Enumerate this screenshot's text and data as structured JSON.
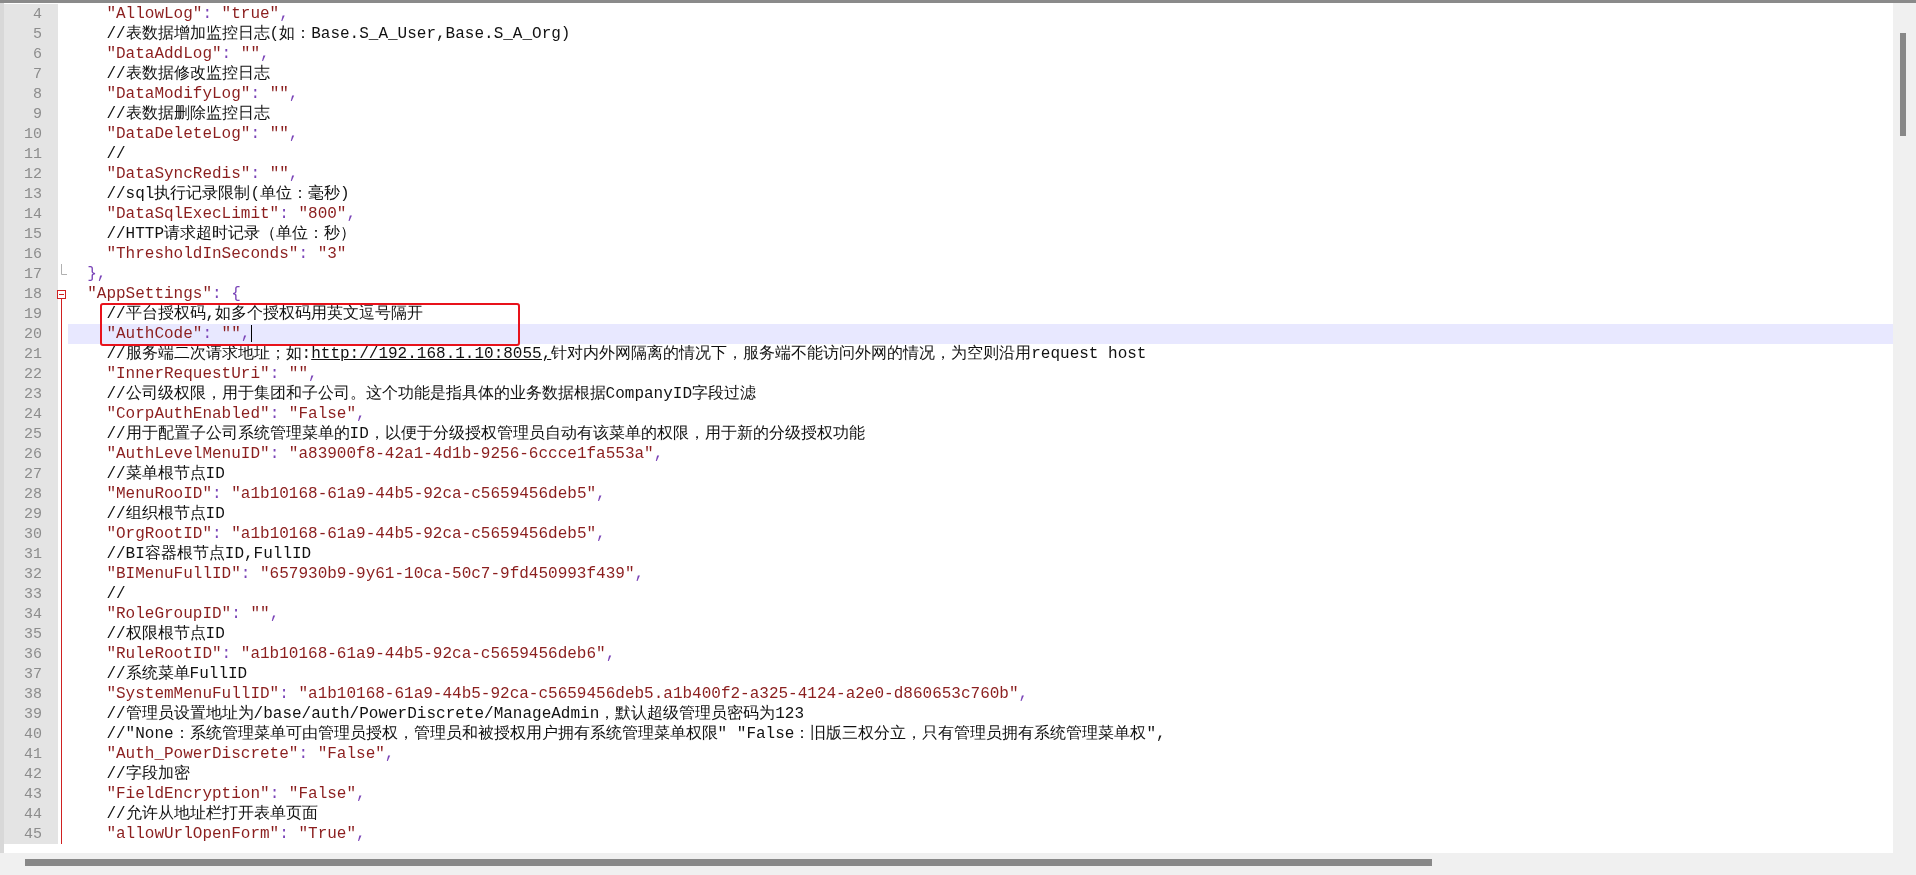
{
  "editor": {
    "lines": [
      {
        "children": [
          {
            "number": "4",
            "current": false,
            "parts": [
              {
                "kind": "key",
                "text": "\"AllowLog\""
              },
              {
                "kind": "punct",
                "text": ": "
              },
              {
                "kind": "string",
                "text": "\"true\""
              },
              {
                "kind": "punct",
                "text": ","
              }
            ]
          },
          {
            "number": "5",
            "current": false,
            "parts": [
              {
                "kind": "comment",
                "text": "//表数据增加监控日志(如：Base.S_A_User,Base.S_A_Org)"
              }
            ]
          },
          {
            "number": "6",
            "current": false,
            "parts": [
              {
                "kind": "key",
                "text": "\"DataAddLog\""
              },
              {
                "kind": "punct",
                "text": ": "
              },
              {
                "kind": "string",
                "text": "\"\""
              },
              {
                "kind": "punct",
                "text": ","
              }
            ]
          },
          {
            "number": "7",
            "current": false,
            "parts": [
              {
                "kind": "comment",
                "text": "//表数据修改监控日志"
              }
            ]
          },
          {
            "number": "8",
            "current": false,
            "parts": [
              {
                "kind": "key",
                "text": "\"DataModifyLog\""
              },
              {
                "kind": "punct",
                "text": ": "
              },
              {
                "kind": "string",
                "text": "\"\""
              },
              {
                "kind": "punct",
                "text": ","
              }
            ]
          },
          {
            "number": "9",
            "current": false,
            "parts": [
              {
                "kind": "comment",
                "text": "//表数据删除监控日志"
              }
            ]
          },
          {
            "number": "10",
            "current": false,
            "parts": [
              {
                "kind": "key",
                "text": "\"DataDeleteLog\""
              },
              {
                "kind": "punct",
                "text": ": "
              },
              {
                "kind": "string",
                "text": "\"\""
              },
              {
                "kind": "punct",
                "text": ","
              }
            ]
          },
          {
            "number": "11",
            "current": false,
            "parts": [
              {
                "kind": "comment",
                "text": "//"
              }
            ]
          },
          {
            "number": "12",
            "current": false,
            "parts": [
              {
                "kind": "key",
                "text": "\"DataSyncRedis\""
              },
              {
                "kind": "punct",
                "text": ": "
              },
              {
                "kind": "string",
                "text": "\"\""
              },
              {
                "kind": "punct",
                "text": ","
              }
            ]
          },
          {
            "number": "13",
            "current": false,
            "parts": [
              {
                "kind": "comment",
                "text": "//sql执行记录限制(单位：毫秒)"
              }
            ]
          },
          {
            "number": "14",
            "current": false,
            "parts": [
              {
                "kind": "key",
                "text": "\"DataSqlExecLimit\""
              },
              {
                "kind": "punct",
                "text": ": "
              },
              {
                "kind": "string",
                "text": "\"800\""
              },
              {
                "kind": "punct",
                "text": ","
              }
            ]
          },
          {
            "number": "15",
            "current": false,
            "parts": [
              {
                "kind": "comment",
                "text": "//HTTP请求超时记录（单位：秒）"
              }
            ]
          },
          {
            "number": "16",
            "current": false,
            "parts": [
              {
                "kind": "key",
                "text": "\"ThresholdInSeconds\""
              },
              {
                "kind": "punct",
                "text": ": "
              },
              {
                "kind": "string",
                "text": "\"3\""
              }
            ]
          }
        ]
      },
      {
        "number": "17",
        "current": false,
        "parts": [
          {
            "kind": "punct",
            "text": "},"
          }
        ]
      },
      {
        "number": "18",
        "current": false,
        "expanded": true,
        "parts": [
          {
            "kind": "key",
            "text": "\"AppSettings\""
          },
          {
            "kind": "punct",
            "text": ": {"
          }
        ],
        "children": [
          {
            "number": "19",
            "current": false,
            "parts": [
              {
                "kind": "comment",
                "text": "//平台授权码,如多个授权码用英文逗号隔开"
              }
            ]
          },
          {
            "number": "20",
            "current": true,
            "parts": [
              {
                "kind": "key",
                "text": "\"AuthCode\""
              },
              {
                "kind": "punct",
                "text": ": "
              },
              {
                "kind": "string",
                "text": "\"\""
              },
              {
                "kind": "punct",
                "text": ","
              }
            ]
          },
          {
            "number": "21",
            "current": false,
            "parts": [
              {
                "kind": "comment",
                "text": "//服务端二次请求地址；如:"
              },
              {
                "kind": "link",
                "text": "http://192.168.1.10:8055,"
              },
              {
                "kind": "comment",
                "text": "针对内外网隔离的情况下，服务端不能访问外网的情况，为空则沿用request host"
              }
            ]
          },
          {
            "number": "22",
            "current": false,
            "parts": [
              {
                "kind": "key",
                "text": "\"InnerRequestUri\""
              },
              {
                "kind": "punct",
                "text": ": "
              },
              {
                "kind": "string",
                "text": "\"\""
              },
              {
                "kind": "punct",
                "text": ","
              }
            ]
          },
          {
            "number": "23",
            "current": false,
            "parts": [
              {
                "kind": "comment",
                "text": "//公司级权限，用于集团和子公司。这个功能是指具体的业务数据根据CompanyID字段过滤"
              }
            ]
          },
          {
            "number": "24",
            "current": false,
            "parts": [
              {
                "kind": "key",
                "text": "\"CorpAuthEnabled\""
              },
              {
                "kind": "punct",
                "text": ": "
              },
              {
                "kind": "string",
                "text": "\"False\""
              },
              {
                "kind": "punct",
                "text": ","
              }
            ]
          },
          {
            "number": "25",
            "current": false,
            "parts": [
              {
                "kind": "comment",
                "text": "//用于配置子公司系统管理菜单的ID，以便于分级授权管理员自动有该菜单的权限，用于新的分级授权功能"
              }
            ]
          },
          {
            "number": "26",
            "current": false,
            "parts": [
              {
                "kind": "key",
                "text": "\"AuthLevelMenuID\""
              },
              {
                "kind": "punct",
                "text": ": "
              },
              {
                "kind": "string",
                "text": "\"a83900f8-42a1-4d1b-9256-6ccce1fa553a\""
              },
              {
                "kind": "punct",
                "text": ","
              }
            ]
          },
          {
            "number": "27",
            "current": false,
            "parts": [
              {
                "kind": "comment",
                "text": "//菜单根节点ID"
              }
            ]
          },
          {
            "number": "28",
            "current": false,
            "parts": [
              {
                "kind": "key",
                "text": "\"MenuRooID\""
              },
              {
                "kind": "punct",
                "text": ": "
              },
              {
                "kind": "string",
                "text": "\"a1b10168-61a9-44b5-92ca-c5659456deb5\""
              },
              {
                "kind": "punct",
                "text": ","
              }
            ]
          },
          {
            "number": "29",
            "current": false,
            "parts": [
              {
                "kind": "comment",
                "text": "//组织根节点ID"
              }
            ]
          },
          {
            "number": "30",
            "current": false,
            "parts": [
              {
                "kind": "key",
                "text": "\"OrgRootID\""
              },
              {
                "kind": "punct",
                "text": ": "
              },
              {
                "kind": "string",
                "text": "\"a1b10168-61a9-44b5-92ca-c5659456deb5\""
              },
              {
                "kind": "punct",
                "text": ","
              }
            ]
          },
          {
            "number": "31",
            "current": false,
            "parts": [
              {
                "kind": "comment",
                "text": "//BI容器根节点ID,FullID"
              }
            ]
          },
          {
            "number": "32",
            "current": false,
            "parts": [
              {
                "kind": "key",
                "text": "\"BIMenuFullID\""
              },
              {
                "kind": "punct",
                "text": ": "
              },
              {
                "kind": "string",
                "text": "\"657930b9-9y61-10ca-50c7-9fd450993f439\""
              },
              {
                "kind": "punct",
                "text": ","
              }
            ]
          },
          {
            "number": "33",
            "current": false,
            "parts": [
              {
                "kind": "comment",
                "text": "//"
              }
            ]
          },
          {
            "number": "34",
            "current": false,
            "parts": [
              {
                "kind": "key",
                "text": "\"RoleGroupID\""
              },
              {
                "kind": "punct",
                "text": ": "
              },
              {
                "kind": "string",
                "text": "\"\""
              },
              {
                "kind": "punct",
                "text": ","
              }
            ]
          },
          {
            "number": "35",
            "current": false,
            "parts": [
              {
                "kind": "comment",
                "text": "//权限根节点ID"
              }
            ]
          },
          {
            "number": "36",
            "current": false,
            "parts": [
              {
                "kind": "key",
                "text": "\"RuleRootID\""
              },
              {
                "kind": "punct",
                "text": ": "
              },
              {
                "kind": "string",
                "text": "\"a1b10168-61a9-44b5-92ca-c5659456deb6\""
              },
              {
                "kind": "punct",
                "text": ","
              }
            ]
          },
          {
            "number": "37",
            "current": false,
            "parts": [
              {
                "kind": "comment",
                "text": "//系统菜单FullID"
              }
            ]
          },
          {
            "number": "38",
            "current": false,
            "parts": [
              {
                "kind": "key",
                "text": "\"SystemMenuFullID\""
              },
              {
                "kind": "punct",
                "text": ": "
              },
              {
                "kind": "string",
                "text": "\"a1b10168-61a9-44b5-92ca-c5659456deb5.a1b400f2-a325-4124-a2e0-d860653c760b\""
              },
              {
                "kind": "punct",
                "text": ","
              }
            ]
          },
          {
            "number": "39",
            "current": false,
            "parts": [
              {
                "kind": "comment",
                "text": "//管理员设置地址为/base/auth/PowerDiscrete/ManageAdmin，默认超级管理员密码为123"
              }
            ]
          },
          {
            "number": "40",
            "current": false,
            "parts": [
              {
                "kind": "comment",
                "text": "//\"None：系统管理菜单可由管理员授权，管理员和被授权用户拥有系统管理菜单权限\" \"False：旧版三权分立，只有管理员拥有系统管理菜单权\","
              }
            ]
          },
          {
            "number": "41",
            "current": false,
            "parts": [
              {
                "kind": "key",
                "text": "\"Auth_PowerDiscrete\""
              },
              {
                "kind": "punct",
                "text": ": "
              },
              {
                "kind": "string",
                "text": "\"False\""
              },
              {
                "kind": "punct",
                "text": ","
              }
            ]
          },
          {
            "number": "42",
            "current": false,
            "parts": [
              {
                "kind": "comment",
                "text": "//字段加密"
              }
            ]
          },
          {
            "number": "43",
            "current": false,
            "parts": [
              {
                "kind": "key",
                "text": "\"FieldEncryption\""
              },
              {
                "kind": "punct",
                "text": ": "
              },
              {
                "kind": "string",
                "text": "\"False\""
              },
              {
                "kind": "punct",
                "text": ","
              }
            ]
          },
          {
            "number": "44",
            "current": false,
            "parts": [
              {
                "kind": "comment",
                "text": "//允许从地址栏打开表单页面"
              }
            ]
          },
          {
            "number": "45",
            "current": false,
            "parts": [
              {
                "kind": "key",
                "text": "\"allowUrlOpenForm\""
              },
              {
                "kind": "punct",
                "text": ": "
              },
              {
                "kind": "string",
                "text": "\"True\""
              },
              {
                "kind": "punct",
                "text": ","
              }
            ]
          }
        ]
      }
    ]
  }
}
